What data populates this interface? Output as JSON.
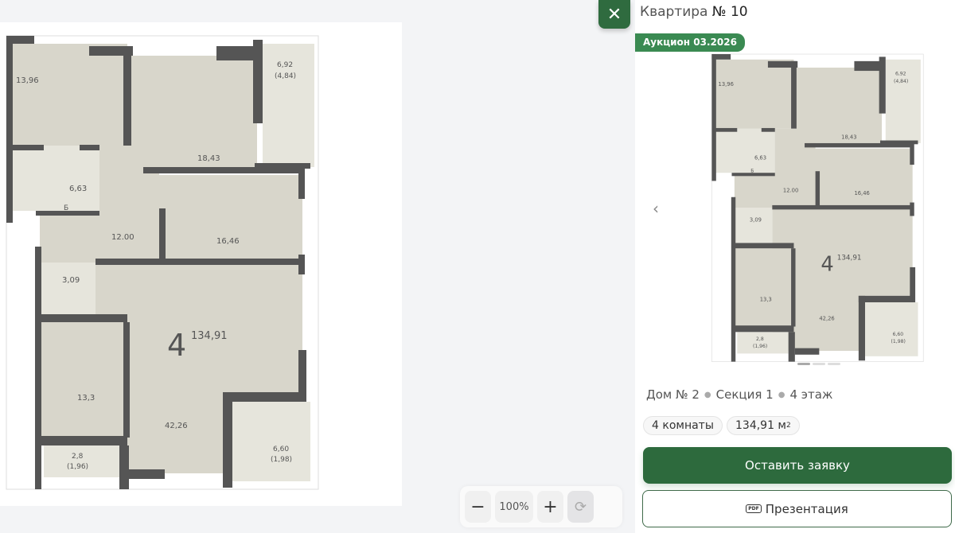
{
  "apartment": {
    "title_prefix": "Квартира",
    "title_number": "№ 10",
    "badge": "Аукцион 03.2026"
  },
  "plan": {
    "rooms_count_label": "4",
    "total_area": "134,91",
    "rooms": [
      {
        "id": "r1",
        "label": "13,96"
      },
      {
        "id": "r2",
        "label": "18,43"
      },
      {
        "id": "bal1",
        "label": "6,92",
        "sub": "(4,84)"
      },
      {
        "id": "bath",
        "label": "6,63"
      },
      {
        "id": "hall",
        "label": "12.00"
      },
      {
        "id": "r3",
        "label": "16,46"
      },
      {
        "id": "wc",
        "label": "3,09"
      },
      {
        "id": "living",
        "label": "42,26"
      },
      {
        "id": "kitchen",
        "label": "13,3"
      },
      {
        "id": "small",
        "label": "2,8",
        "sub": "(1,96)"
      },
      {
        "id": "bal2",
        "label": "6,60",
        "sub": "(1,98)"
      }
    ],
    "boiler_label": "Б"
  },
  "details": {
    "house": "Дом № 2",
    "section": "Секция 1",
    "floor": "4 этаж",
    "rooms": "4 комнаты",
    "area": "134,91 м",
    "area_unit_sup": "2"
  },
  "actions": {
    "apply": "Оставить заявку",
    "presentation": "Презентация",
    "pdf_icon_text": "PDF"
  },
  "zoom": {
    "minus": "−",
    "value": "100%",
    "plus": "+",
    "reset": "⟳"
  },
  "icons": {
    "close": "close-icon",
    "prev": "chevron-left-icon"
  },
  "colors": {
    "accent": "#2d6a3d",
    "badge": "#3a8a52"
  }
}
